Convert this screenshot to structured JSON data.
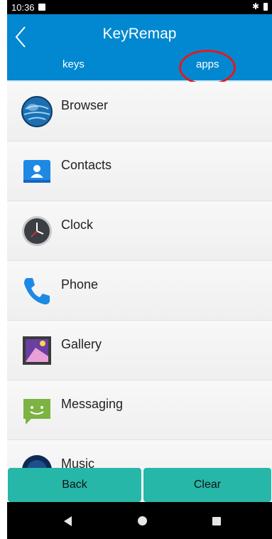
{
  "status_bar": {
    "time": "10:36",
    "bluetooth_icon": "bluetooth-icon",
    "battery_icon": "battery-icon"
  },
  "app_bar": {
    "back_icon": "chevron-left-icon",
    "title": "KeyRemap",
    "tabs": [
      {
        "label": "keys"
      },
      {
        "label": "apps",
        "selected": true
      }
    ]
  },
  "apps": [
    {
      "label": "Browser",
      "icon": "globe-icon"
    },
    {
      "label": "Contacts",
      "icon": "contacts-icon"
    },
    {
      "label": "Clock",
      "icon": "clock-icon"
    },
    {
      "label": "Phone",
      "icon": "phone-icon"
    },
    {
      "label": "Gallery",
      "icon": "gallery-icon"
    },
    {
      "label": "Messaging",
      "icon": "messaging-icon"
    },
    {
      "label": "Music",
      "icon": "music-icon"
    }
  ],
  "buttons": {
    "back": "Back",
    "clear": "Clear"
  },
  "colors": {
    "primary": "#0288d1",
    "button": "#26b7a9",
    "annotation": "#e5191b"
  }
}
